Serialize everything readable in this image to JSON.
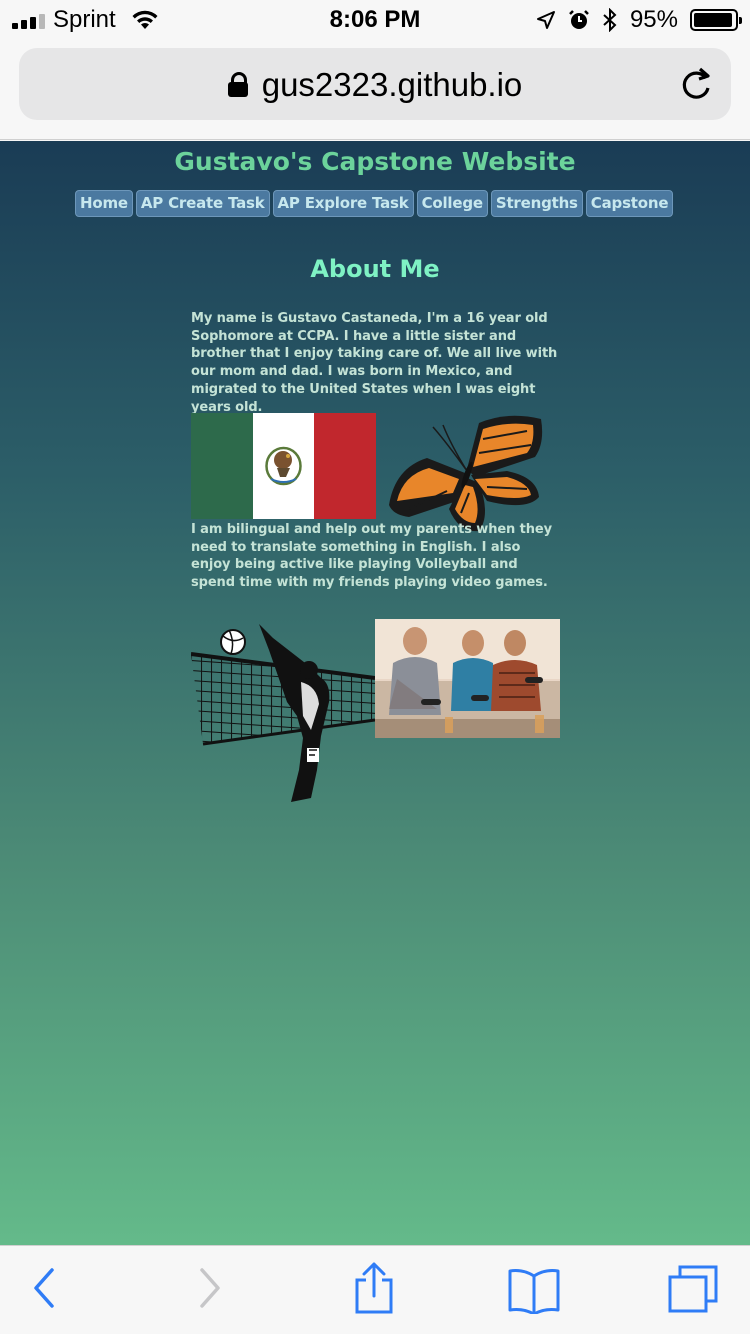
{
  "status_bar": {
    "carrier": "Sprint",
    "time": "8:06 PM",
    "battery": "95%",
    "battery_level": 0.95,
    "icons": [
      "signal-icon",
      "wifi-icon",
      "location-icon",
      "alarm-icon",
      "bluetooth-icon",
      "battery-icon"
    ]
  },
  "browser": {
    "url": "gus2323.github.io",
    "icons": [
      "lock-icon",
      "reload-icon"
    ]
  },
  "site": {
    "title": "Gustavo's Capstone Website",
    "nav": [
      "Home",
      "AP Create Task",
      "AP Explore Task",
      "College",
      "Strengths",
      "Capstone"
    ],
    "heading": "About Me",
    "paragraph1": "My name is Gustavo Castaneda, I'm a 16 year old Sophomore at CCPA. I have a little sister and brother that I enjoy taking care of. We all live with our mom and dad. I was born in Mexico, and migrated to the United States when I was eight years old.",
    "paragraph2": "I am bilingual and help out my parents when they need to translate something in English. I also enjoy being active like playing Volleyball and spend time with my friends playing video games.",
    "images": [
      "mexican-flag",
      "monarch-butterfly",
      "volleyball-player",
      "friends-playing-video-games"
    ]
  },
  "toolbar": {
    "icons": [
      "back-icon",
      "forward-icon",
      "share-icon",
      "bookmarks-icon",
      "tabs-icon"
    ]
  },
  "colors": {
    "gradient_top": "#1a3c55",
    "gradient_bottom": "#64ba8a",
    "title": "#6cd39b",
    "heading": "#7ff2c4",
    "nav_bg": "#4b79a0",
    "ios_blue": "#2f7cf6"
  }
}
